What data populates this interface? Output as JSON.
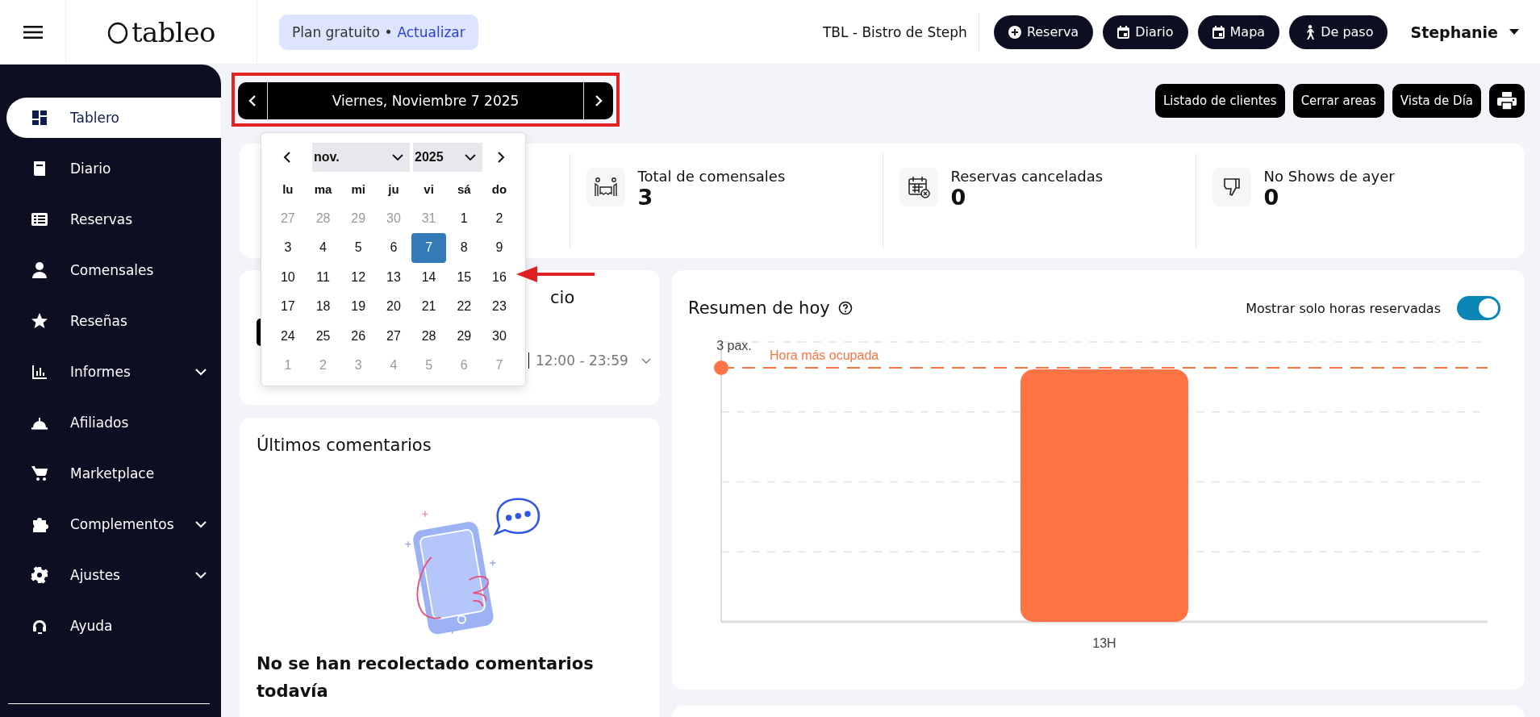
{
  "header": {
    "logo": "tableo",
    "plan": {
      "label": "Plan gratuito •",
      "link": "Actualizar"
    },
    "venue": "TBL - Bistro de Steph",
    "actions": [
      "Reserva",
      "Diario",
      "Mapa",
      "De paso"
    ],
    "user": "Stephanie"
  },
  "sidebar": {
    "items": [
      {
        "label": "Tablero",
        "selected": true,
        "expandable": false
      },
      {
        "label": "Diario",
        "selected": false,
        "expandable": false
      },
      {
        "label": "Reservas",
        "selected": false,
        "expandable": false
      },
      {
        "label": "Comensales",
        "selected": false,
        "expandable": false
      },
      {
        "label": "Reseñas",
        "selected": false,
        "expandable": false
      },
      {
        "label": "Informes",
        "selected": false,
        "expandable": true
      },
      {
        "label": "Afiliados",
        "selected": false,
        "expandable": false
      },
      {
        "label": "Marketplace",
        "selected": false,
        "expandable": false
      },
      {
        "label": "Complementos",
        "selected": false,
        "expandable": true
      },
      {
        "label": "Ajustes",
        "selected": false,
        "expandable": true
      },
      {
        "label": "Ayuda",
        "selected": false,
        "expandable": false
      }
    ]
  },
  "date_nav": {
    "label": "Viernes, Noviembre 7 2025"
  },
  "toolbar": {
    "buttons": [
      "Listado de clientes",
      "Cerrar areas",
      "Vista de Día"
    ]
  },
  "datepicker": {
    "month": "nov.",
    "year": "2025",
    "weekdays": [
      "lu",
      "ma",
      "mi",
      "ju",
      "vi",
      "sá",
      "do"
    ],
    "weeks": [
      [
        {
          "day": "27",
          "outside": true,
          "selected": false
        },
        {
          "day": "28",
          "outside": true,
          "selected": false
        },
        {
          "day": "29",
          "outside": true,
          "selected": false
        },
        {
          "day": "30",
          "outside": true,
          "selected": false
        },
        {
          "day": "31",
          "outside": true,
          "selected": false
        },
        {
          "day": "1",
          "outside": false,
          "selected": false
        },
        {
          "day": "2",
          "outside": false,
          "selected": false
        }
      ],
      [
        {
          "day": "3",
          "outside": false,
          "selected": false
        },
        {
          "day": "4",
          "outside": false,
          "selected": false
        },
        {
          "day": "5",
          "outside": false,
          "selected": false
        },
        {
          "day": "6",
          "outside": false,
          "selected": false
        },
        {
          "day": "7",
          "outside": false,
          "selected": true
        },
        {
          "day": "8",
          "outside": false,
          "selected": false
        },
        {
          "day": "9",
          "outside": false,
          "selected": false
        }
      ],
      [
        {
          "day": "10",
          "outside": false,
          "selected": false
        },
        {
          "day": "11",
          "outside": false,
          "selected": false
        },
        {
          "day": "12",
          "outside": false,
          "selected": false
        },
        {
          "day": "13",
          "outside": false,
          "selected": false
        },
        {
          "day": "14",
          "outside": false,
          "selected": false
        },
        {
          "day": "15",
          "outside": false,
          "selected": false
        },
        {
          "day": "16",
          "outside": false,
          "selected": false
        }
      ],
      [
        {
          "day": "17",
          "outside": false,
          "selected": false
        },
        {
          "day": "18",
          "outside": false,
          "selected": false
        },
        {
          "day": "19",
          "outside": false,
          "selected": false
        },
        {
          "day": "20",
          "outside": false,
          "selected": false
        },
        {
          "day": "21",
          "outside": false,
          "selected": false
        },
        {
          "day": "22",
          "outside": false,
          "selected": false
        },
        {
          "day": "23",
          "outside": false,
          "selected": false
        }
      ],
      [
        {
          "day": "24",
          "outside": false,
          "selected": false
        },
        {
          "day": "25",
          "outside": false,
          "selected": false
        },
        {
          "day": "26",
          "outside": false,
          "selected": false
        },
        {
          "day": "27",
          "outside": false,
          "selected": false
        },
        {
          "day": "28",
          "outside": false,
          "selected": false
        },
        {
          "day": "29",
          "outside": false,
          "selected": false
        },
        {
          "day": "30",
          "outside": false,
          "selected": false
        }
      ],
      [
        {
          "day": "1",
          "outside": true,
          "selected": false
        },
        {
          "day": "2",
          "outside": true,
          "selected": false
        },
        {
          "day": "3",
          "outside": true,
          "selected": false
        },
        {
          "day": "4",
          "outside": true,
          "selected": false
        },
        {
          "day": "5",
          "outside": true,
          "selected": false
        },
        {
          "day": "6",
          "outside": true,
          "selected": false
        },
        {
          "day": "7",
          "outside": true,
          "selected": false
        }
      ]
    ]
  },
  "stats": [
    {
      "label": "Total de comensales",
      "value": "3"
    },
    {
      "label": "Reservas canceladas",
      "value": "0"
    },
    {
      "label": "No Shows de ayer",
      "value": "0"
    }
  ],
  "occupancy_card": {
    "title_end": "cio",
    "time_range": "12:00 - 23:59"
  },
  "comments": {
    "title": "Últimos comentarios",
    "empty_message": "No se han recolectado comentarios todavía"
  },
  "summary": {
    "title": "Resumen de hoy",
    "toggle": {
      "label": "Mostrar solo horas reservadas",
      "on": true
    },
    "chart": {
      "peak_value_label": "3 pax.",
      "peak_annotation": "Hora más ocupada",
      "bar_labels": [
        "13H"
      ]
    }
  }
}
